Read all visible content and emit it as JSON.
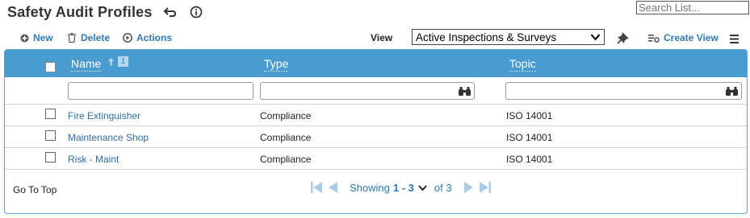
{
  "header": {
    "title": "Safety Audit Profiles",
    "search_placeholder": "Search List..."
  },
  "toolbar": {
    "new_label": "New",
    "delete_label": "Delete",
    "actions_label": "Actions",
    "view_label": "View",
    "view_selected": "Active Inspections & Surveys",
    "create_view_label": "Create View"
  },
  "grid": {
    "columns": [
      "Name",
      "Type",
      "Topic"
    ],
    "sort_order": "1",
    "rows": [
      {
        "name": "Fire Extinguisher",
        "type": "Compliance",
        "topic": "ISO 14001"
      },
      {
        "name": "Maintenance Shop",
        "type": "Compliance",
        "topic": "ISO 14001"
      },
      {
        "name": "Risk - Maint",
        "type": "Compliance",
        "topic": "ISO 14001"
      }
    ]
  },
  "footer": {
    "go_top_label": "Go To Top",
    "showing_label": "Showing",
    "range": "1 - 3",
    "of_label": "of 3"
  },
  "colors": {
    "header_bg": "#4a9bd0",
    "link": "#2f7ab5",
    "border": "#5ba3d4"
  }
}
